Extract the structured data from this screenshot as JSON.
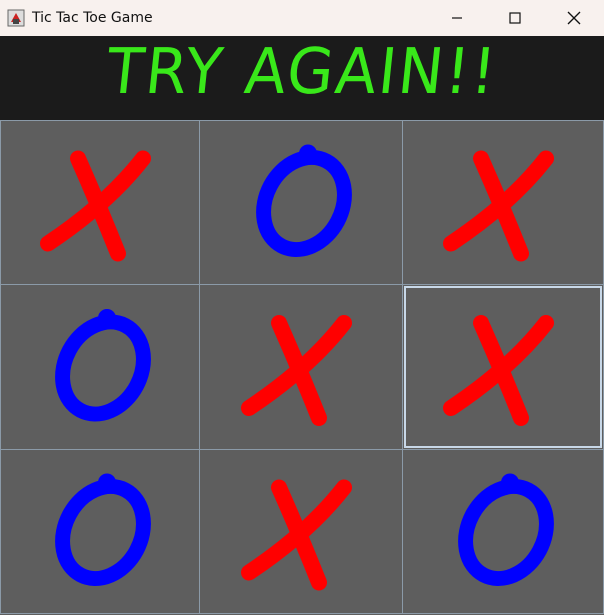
{
  "window": {
    "title": "Tic Tac Toe Game",
    "controls": [
      "minimize-icon",
      "maximize-icon",
      "close-icon"
    ]
  },
  "banner": {
    "text": "TRY AGAIN!!",
    "color": "#39e81a"
  },
  "board": {
    "cells": [
      "X",
      "O",
      "X",
      "O",
      "X",
      "X",
      "O",
      "X",
      "O"
    ],
    "selected_index": 5,
    "x_color": "#ff0000",
    "o_color": "#0000ff"
  }
}
